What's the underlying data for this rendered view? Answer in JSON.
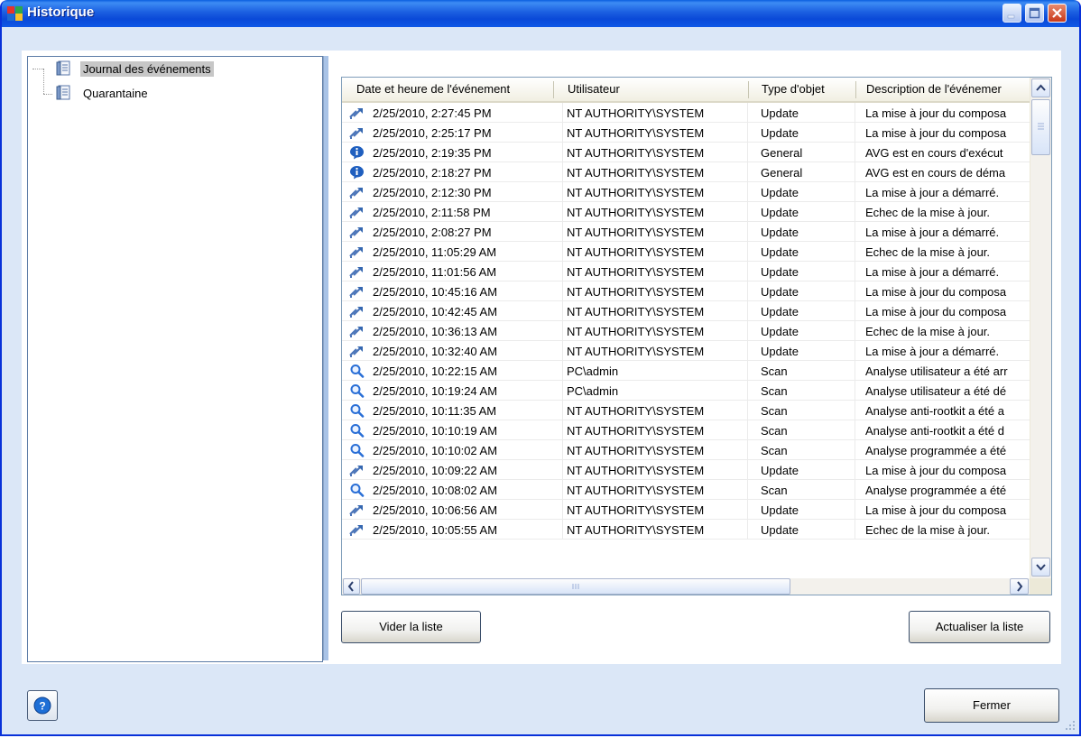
{
  "window": {
    "title": "Historique"
  },
  "tree": {
    "items": [
      {
        "label": "Journal des événements",
        "selected": true
      },
      {
        "label": "Quarantaine",
        "selected": false
      }
    ]
  },
  "table": {
    "columns": [
      "Date et heure de l'événement",
      "Utilisateur",
      "Type d'objet",
      "Description de l'événemer"
    ],
    "rows": [
      {
        "icon": "update-icon",
        "date": "2/25/2010, 2:27:45 PM",
        "user": "NT AUTHORITY\\SYSTEM",
        "type": "Update",
        "desc": "La mise à jour du composa"
      },
      {
        "icon": "update-icon",
        "date": "2/25/2010, 2:25:17 PM",
        "user": "NT AUTHORITY\\SYSTEM",
        "type": "Update",
        "desc": "La mise à jour du composa"
      },
      {
        "icon": "info-icon",
        "date": "2/25/2010, 2:19:35 PM",
        "user": "NT AUTHORITY\\SYSTEM",
        "type": "General",
        "desc": "AVG est en cours d'exécut"
      },
      {
        "icon": "info-icon",
        "date": "2/25/2010, 2:18:27 PM",
        "user": "NT AUTHORITY\\SYSTEM",
        "type": "General",
        "desc": "AVG est en cours de déma"
      },
      {
        "icon": "update-icon",
        "date": "2/25/2010, 2:12:30 PM",
        "user": "NT AUTHORITY\\SYSTEM",
        "type": "Update",
        "desc": "La mise à jour a démarré."
      },
      {
        "icon": "update-icon",
        "date": "2/25/2010, 2:11:58 PM",
        "user": "NT AUTHORITY\\SYSTEM",
        "type": "Update",
        "desc": "Echec de la mise à jour."
      },
      {
        "icon": "update-icon",
        "date": "2/25/2010, 2:08:27 PM",
        "user": "NT AUTHORITY\\SYSTEM",
        "type": "Update",
        "desc": "La mise à jour a démarré."
      },
      {
        "icon": "update-icon",
        "date": "2/25/2010, 11:05:29 AM",
        "user": "NT AUTHORITY\\SYSTEM",
        "type": "Update",
        "desc": "Echec de la mise à jour."
      },
      {
        "icon": "update-icon",
        "date": "2/25/2010, 11:01:56 AM",
        "user": "NT AUTHORITY\\SYSTEM",
        "type": "Update",
        "desc": "La mise à jour a démarré."
      },
      {
        "icon": "update-icon",
        "date": "2/25/2010, 10:45:16 AM",
        "user": "NT AUTHORITY\\SYSTEM",
        "type": "Update",
        "desc": "La mise à jour du composa"
      },
      {
        "icon": "update-icon",
        "date": "2/25/2010, 10:42:45 AM",
        "user": "NT AUTHORITY\\SYSTEM",
        "type": "Update",
        "desc": "La mise à jour du composa"
      },
      {
        "icon": "update-icon",
        "date": "2/25/2010, 10:36:13 AM",
        "user": "NT AUTHORITY\\SYSTEM",
        "type": "Update",
        "desc": "Echec de la mise à jour."
      },
      {
        "icon": "update-icon",
        "date": "2/25/2010, 10:32:40 AM",
        "user": "NT AUTHORITY\\SYSTEM",
        "type": "Update",
        "desc": "La mise à jour a démarré."
      },
      {
        "icon": "scan-icon",
        "date": "2/25/2010, 10:22:15 AM",
        "user": "PC\\admin",
        "type": "Scan",
        "desc": "Analyse utilisateur a été arr"
      },
      {
        "icon": "scan-icon",
        "date": "2/25/2010, 10:19:24 AM",
        "user": "PC\\admin",
        "type": "Scan",
        "desc": "Analyse utilisateur a été dé"
      },
      {
        "icon": "scan-icon",
        "date": "2/25/2010, 10:11:35 AM",
        "user": "NT AUTHORITY\\SYSTEM",
        "type": "Scan",
        "desc": "Analyse anti-rootkit a été a"
      },
      {
        "icon": "scan-icon",
        "date": "2/25/2010, 10:10:19 AM",
        "user": "NT AUTHORITY\\SYSTEM",
        "type": "Scan",
        "desc": "Analyse anti-rootkit a été d"
      },
      {
        "icon": "scan-icon",
        "date": "2/25/2010, 10:10:02 AM",
        "user": "NT AUTHORITY\\SYSTEM",
        "type": "Scan",
        "desc": "Analyse programmée a été"
      },
      {
        "icon": "update-icon",
        "date": "2/25/2010, 10:09:22 AM",
        "user": "NT AUTHORITY\\SYSTEM",
        "type": "Update",
        "desc": "La mise à jour du composa"
      },
      {
        "icon": "scan-icon",
        "date": "2/25/2010, 10:08:02 AM",
        "user": "NT AUTHORITY\\SYSTEM",
        "type": "Scan",
        "desc": "Analyse programmée a été"
      },
      {
        "icon": "update-icon",
        "date": "2/25/2010, 10:06:56 AM",
        "user": "NT AUTHORITY\\SYSTEM",
        "type": "Update",
        "desc": "La mise à jour du composa"
      },
      {
        "icon": "update-icon",
        "date": "2/25/2010, 10:05:55 AM",
        "user": "NT AUTHORITY\\SYSTEM",
        "type": "Update",
        "desc": "Echec de la mise à jour."
      }
    ]
  },
  "buttons": {
    "clear": "Vider la liste",
    "refresh": "Actualiser la liste",
    "close": "Fermer"
  },
  "colors": {
    "titlebar": "#0a49d8",
    "info_icon": "#1f5fbf",
    "scan_icon": "#2a6fd6"
  }
}
